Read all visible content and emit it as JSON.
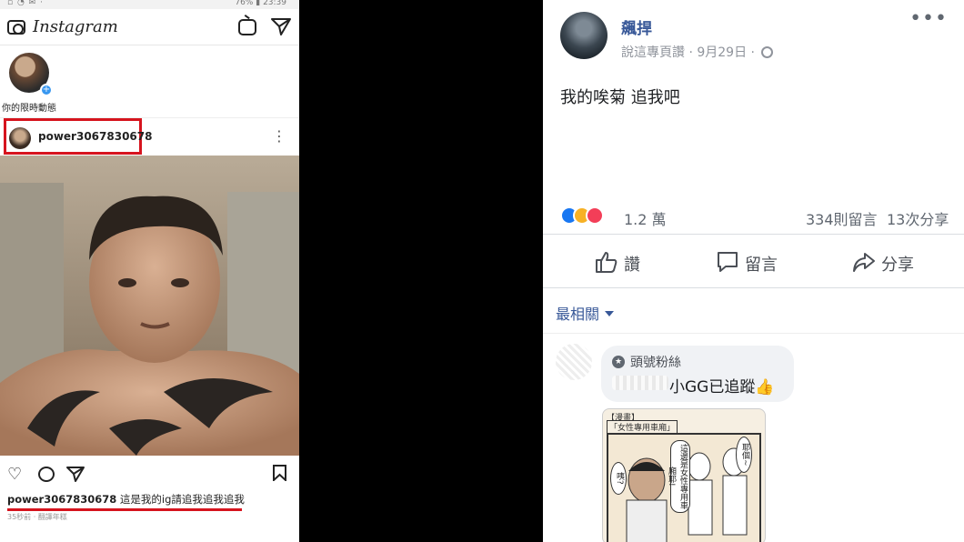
{
  "instagram": {
    "status": {
      "battery": "76%",
      "time": "23:39"
    },
    "logo": "Instagram",
    "story_label": "你的限時動態",
    "post": {
      "username": "power3067830678",
      "caption_user": "power3067830678",
      "caption_text": "這是我的ig請追我追我追我",
      "meta": "35秒前 · 翻譯年糕"
    },
    "colors": {
      "highlight": "#d6141e",
      "story_plus": "#3897f0"
    }
  },
  "facebook": {
    "page_name": "飆捍",
    "post_meta": "說這專頁讚 · 9月29日 ·",
    "post_text": "我的唉菊 追我吧",
    "reactions": {
      "count": "1.2 萬",
      "types": [
        "like",
        "haha",
        "love"
      ]
    },
    "comments_count": "334則留言",
    "shares_count": "13次分享",
    "actions": {
      "like": "讚",
      "comment": "留言",
      "share": "分享"
    },
    "sort_label": "最相關",
    "comment": {
      "badge": "頭號粉絲",
      "text": "小GG已追蹤👍",
      "image_caption_1": "【漫畫】",
      "image_caption_2": "「女性專用車廂」",
      "bubbles": [
        "咦?",
        "這邊是女性專用車廂耶!",
        "耶個~"
      ]
    },
    "colors": {
      "link": "#385898",
      "like": "#1877f2",
      "haha": "#f7b125",
      "love": "#f33e58"
    }
  }
}
